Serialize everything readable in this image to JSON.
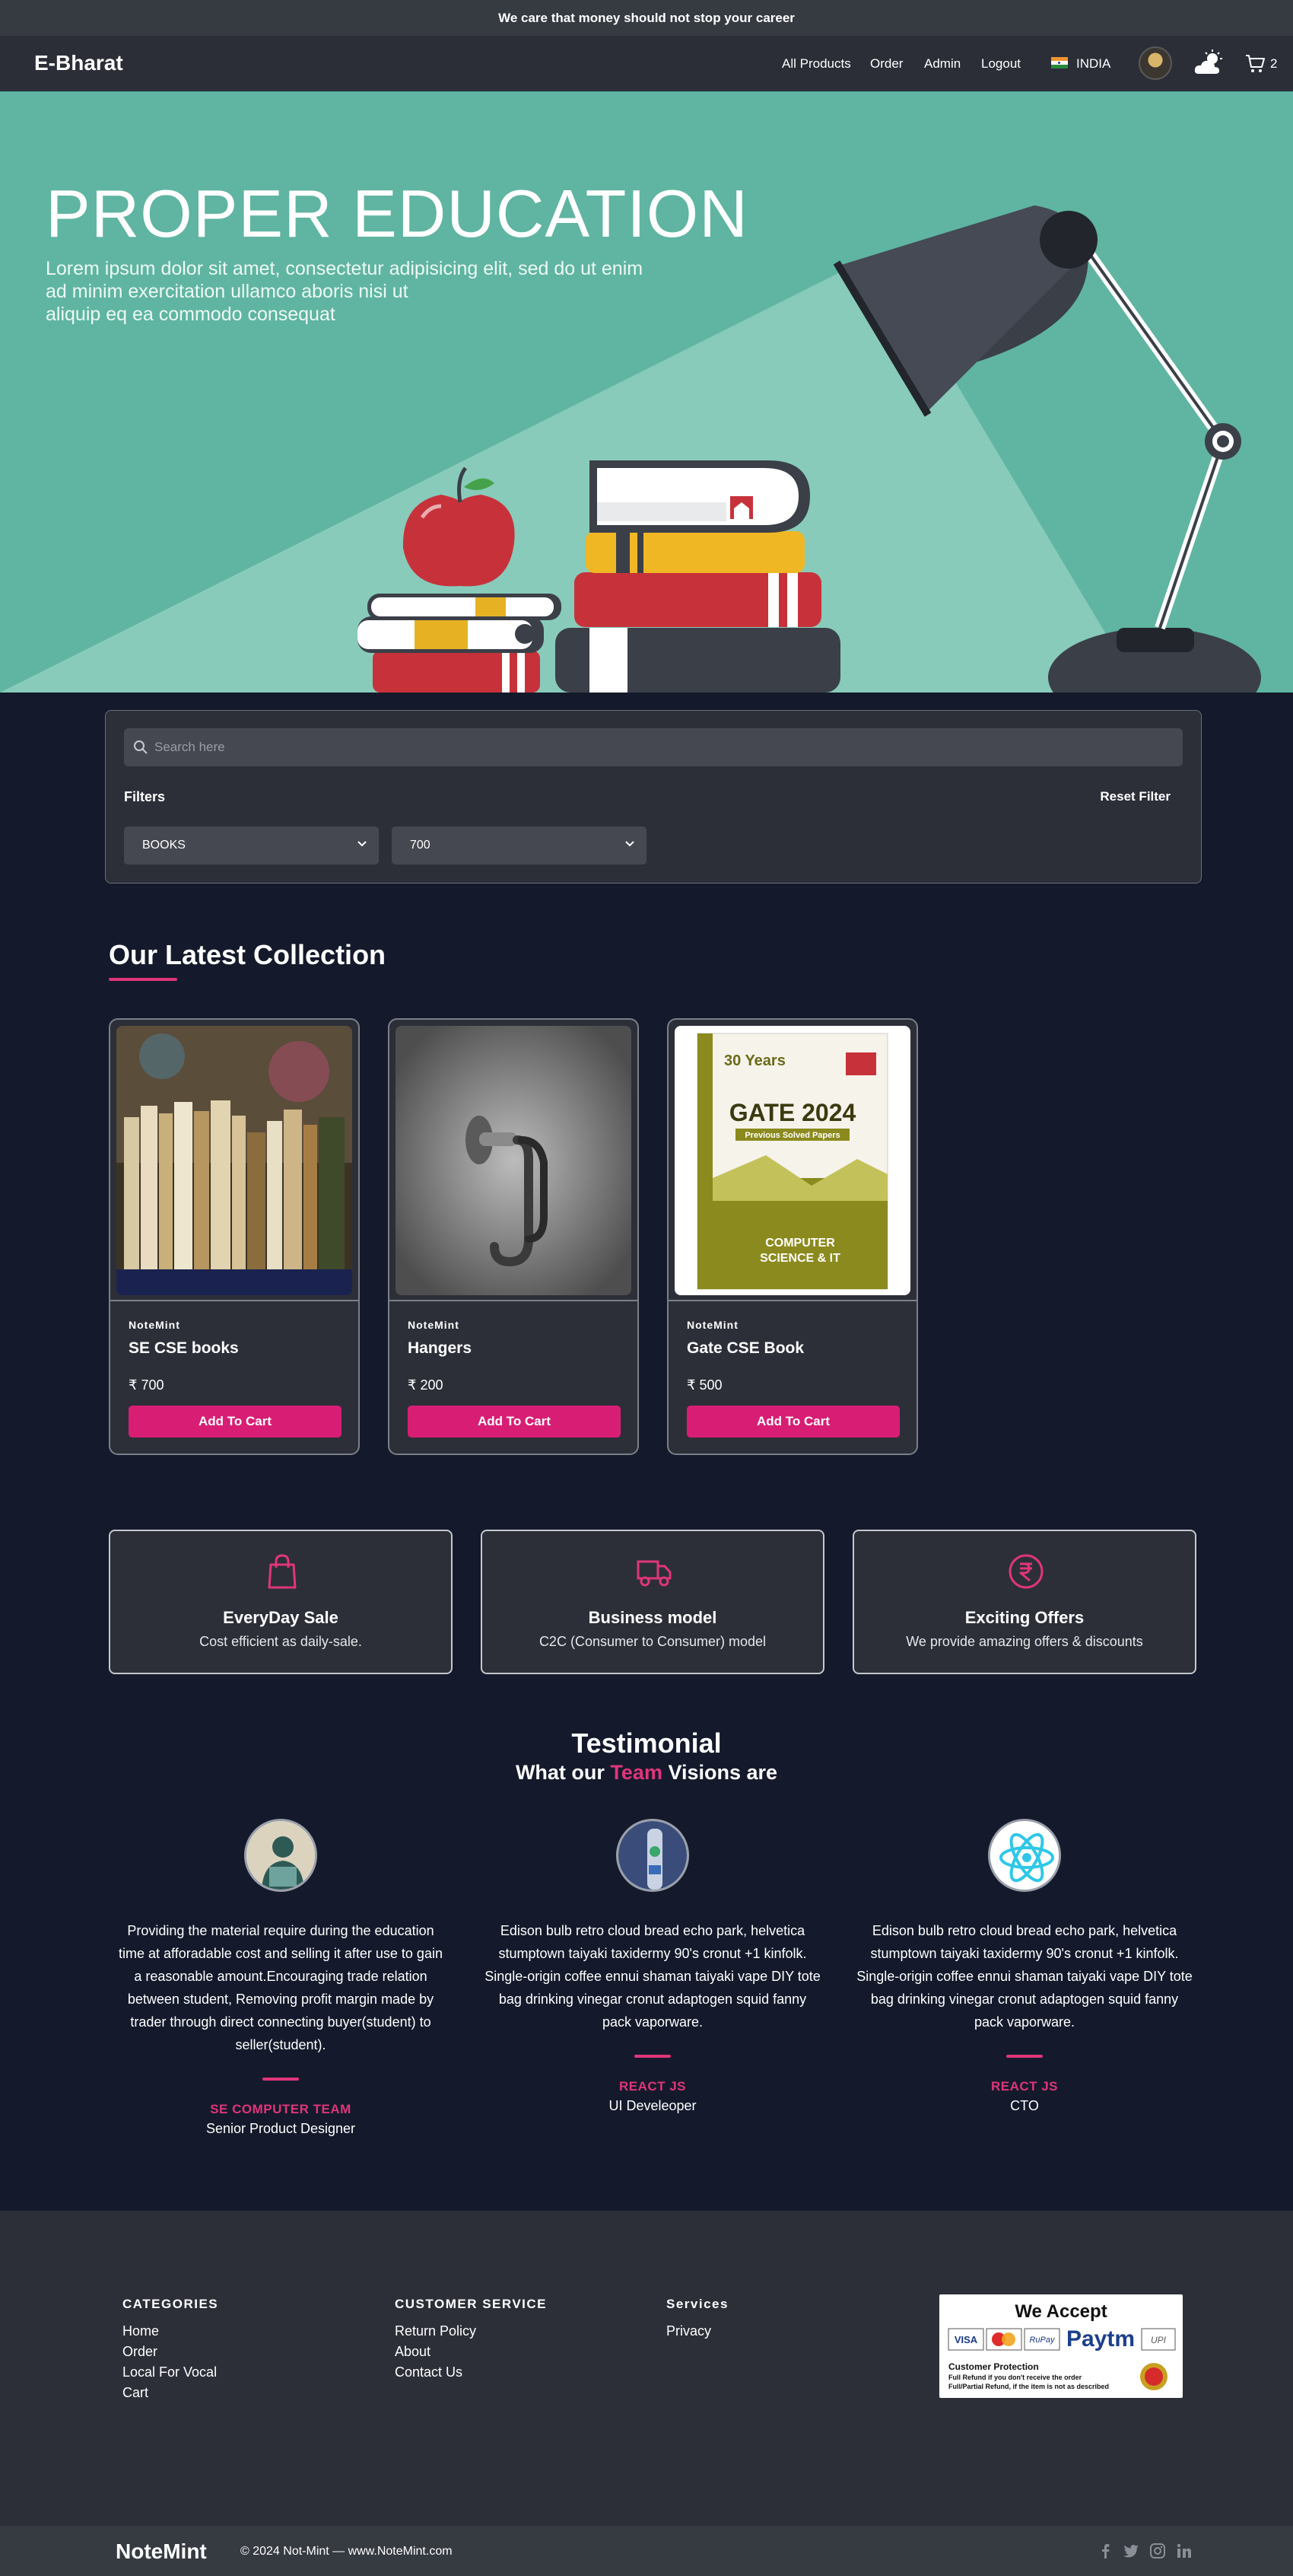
{
  "announcement": "We care that money should not stop your career",
  "nav": {
    "brand": "E-Bharat",
    "links": [
      "All Products",
      "Order",
      "Admin",
      "Logout"
    ],
    "country": "INDIA",
    "cart_count": "2"
  },
  "hero": {
    "title": "PROPER EDUCATION",
    "subtitle_lines": [
      "Lorem ipsum dolor sit amet, consectetur adipisicing elit, sed do ut enim",
      "ad minim exercitation ullamco aboris nisi ut",
      "aliquip eq ea commodo consequat"
    ]
  },
  "filter": {
    "search_placeholder": "Search here",
    "filters_label": "Filters",
    "reset_label": "Reset Filter",
    "category_value": "BOOKS",
    "price_value": "700"
  },
  "collection": {
    "title": "Our Latest Collection",
    "products": [
      {
        "brand": "NoteMint",
        "name": "SE CSE books",
        "price": "₹ 700",
        "button": "Add To Cart"
      },
      {
        "brand": "NoteMint",
        "name": "Hangers",
        "price": "₹ 200",
        "button": "Add To Cart"
      },
      {
        "brand": "NoteMint",
        "name": "Gate CSE Book",
        "price": "₹ 500",
        "button": "Add To Cart"
      }
    ],
    "gate_cover": {
      "top": "30 Years",
      "title": "GATE 2024",
      "band": "Previous Solved Papers",
      "bottom1": "COMPUTER",
      "bottom2": "SCIENCE & IT"
    }
  },
  "features": [
    {
      "icon": "shopping-bag-icon",
      "title": "EveryDay Sale",
      "desc": "Cost efficient as daily-sale."
    },
    {
      "icon": "truck-icon",
      "title": "Business model",
      "desc": "C2C (Consumer to Consumer) model"
    },
    {
      "icon": "rupee-icon",
      "title": "Exciting Offers",
      "desc": "We provide amazing offers & discounts"
    }
  ],
  "testimonial": {
    "title": "Testimonial",
    "sub_pre": "What our ",
    "sub_accent": "Team",
    "sub_post": " Visions are",
    "items": [
      {
        "lines": [
          "Providing the material require during the education",
          "time at afforadable cost and selling it after use to gain",
          "a reasonable amount.Encouraging trade relation",
          "between student, Removing profit margin made by",
          "trader through direct connecting buyer(student) to",
          "seller(student)."
        ],
        "team": "SE COMPUTER TEAM",
        "role": "Senior Product Designer"
      },
      {
        "lines": [
          "Edison bulb retro cloud bread echo park, helvetica",
          "stumptown taiyaki taxidermy 90's cronut +1 kinfolk.",
          "Single-origin coffee ennui shaman taiyaki vape DIY tote",
          "bag drinking vinegar cronut adaptogen squid fanny",
          "pack vaporware."
        ],
        "team": "REACT JS",
        "role": "UI Develeoper"
      },
      {
        "lines": [
          "Edison bulb retro cloud bread echo park, helvetica",
          "stumptown taiyaki taxidermy 90's cronut +1 kinfolk.",
          "Single-origin coffee ennui shaman taiyaki vape DIY tote",
          "bag drinking vinegar cronut adaptogen squid fanny",
          "pack vaporware."
        ],
        "team": "REACT JS",
        "role": "CTO"
      }
    ]
  },
  "footer": {
    "categories": {
      "title": "CATEGORIES",
      "links": [
        "Home",
        "Order",
        "Local For Vocal",
        "Cart"
      ]
    },
    "service": {
      "title": "CUSTOMER SERVICE",
      "links": [
        "Return Policy",
        "About",
        "Contact Us"
      ]
    },
    "services": {
      "title": "Services",
      "links": [
        "Privacy"
      ]
    },
    "accept": {
      "title": "We Accept",
      "cards": [
        "VISA",
        "RuPay",
        "Paytm",
        "UPI"
      ],
      "protection_title": "Customer Protection",
      "protection_line1": "Full Refund if you don't receive the order",
      "protection_line2": "Full/Partial Refund, if the item is not as described"
    },
    "brand": "NoteMint",
    "copyright": "© 2024 Not-Mint — www.NoteMint.com",
    "social_icons": [
      "facebook-icon",
      "twitter-icon",
      "instagram-icon",
      "linkedin-icon"
    ]
  },
  "colors": {
    "accent": "#e0357a",
    "button": "#d81e74",
    "hero_bg": "#5fb5a1",
    "page_bg": "#141a2b",
    "panel_bg": "#2c2f38"
  }
}
